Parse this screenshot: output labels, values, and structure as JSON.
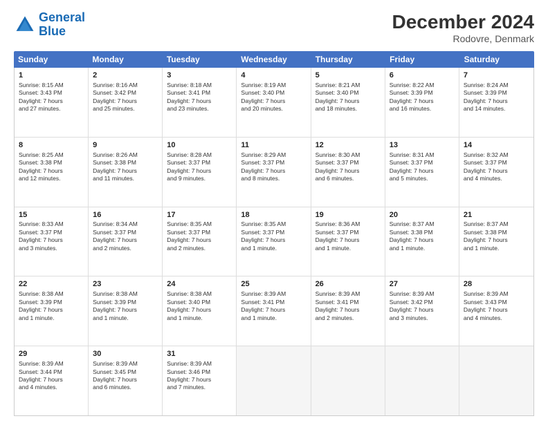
{
  "header": {
    "logo_line1": "General",
    "logo_line2": "Blue",
    "main_title": "December 2024",
    "subtitle": "Rodovre, Denmark"
  },
  "days_of_week": [
    "Sunday",
    "Monday",
    "Tuesday",
    "Wednesday",
    "Thursday",
    "Friday",
    "Saturday"
  ],
  "weeks": [
    [
      {
        "day": "1",
        "lines": [
          "Sunrise: 8:15 AM",
          "Sunset: 3:43 PM",
          "Daylight: 7 hours",
          "and 27 minutes."
        ]
      },
      {
        "day": "2",
        "lines": [
          "Sunrise: 8:16 AM",
          "Sunset: 3:42 PM",
          "Daylight: 7 hours",
          "and 25 minutes."
        ]
      },
      {
        "day": "3",
        "lines": [
          "Sunrise: 8:18 AM",
          "Sunset: 3:41 PM",
          "Daylight: 7 hours",
          "and 23 minutes."
        ]
      },
      {
        "day": "4",
        "lines": [
          "Sunrise: 8:19 AM",
          "Sunset: 3:40 PM",
          "Daylight: 7 hours",
          "and 20 minutes."
        ]
      },
      {
        "day": "5",
        "lines": [
          "Sunrise: 8:21 AM",
          "Sunset: 3:40 PM",
          "Daylight: 7 hours",
          "and 18 minutes."
        ]
      },
      {
        "day": "6",
        "lines": [
          "Sunrise: 8:22 AM",
          "Sunset: 3:39 PM",
          "Daylight: 7 hours",
          "and 16 minutes."
        ]
      },
      {
        "day": "7",
        "lines": [
          "Sunrise: 8:24 AM",
          "Sunset: 3:39 PM",
          "Daylight: 7 hours",
          "and 14 minutes."
        ]
      }
    ],
    [
      {
        "day": "8",
        "lines": [
          "Sunrise: 8:25 AM",
          "Sunset: 3:38 PM",
          "Daylight: 7 hours",
          "and 12 minutes."
        ]
      },
      {
        "day": "9",
        "lines": [
          "Sunrise: 8:26 AM",
          "Sunset: 3:38 PM",
          "Daylight: 7 hours",
          "and 11 minutes."
        ]
      },
      {
        "day": "10",
        "lines": [
          "Sunrise: 8:28 AM",
          "Sunset: 3:37 PM",
          "Daylight: 7 hours",
          "and 9 minutes."
        ]
      },
      {
        "day": "11",
        "lines": [
          "Sunrise: 8:29 AM",
          "Sunset: 3:37 PM",
          "Daylight: 7 hours",
          "and 8 minutes."
        ]
      },
      {
        "day": "12",
        "lines": [
          "Sunrise: 8:30 AM",
          "Sunset: 3:37 PM",
          "Daylight: 7 hours",
          "and 6 minutes."
        ]
      },
      {
        "day": "13",
        "lines": [
          "Sunrise: 8:31 AM",
          "Sunset: 3:37 PM",
          "Daylight: 7 hours",
          "and 5 minutes."
        ]
      },
      {
        "day": "14",
        "lines": [
          "Sunrise: 8:32 AM",
          "Sunset: 3:37 PM",
          "Daylight: 7 hours",
          "and 4 minutes."
        ]
      }
    ],
    [
      {
        "day": "15",
        "lines": [
          "Sunrise: 8:33 AM",
          "Sunset: 3:37 PM",
          "Daylight: 7 hours",
          "and 3 minutes."
        ]
      },
      {
        "day": "16",
        "lines": [
          "Sunrise: 8:34 AM",
          "Sunset: 3:37 PM",
          "Daylight: 7 hours",
          "and 2 minutes."
        ]
      },
      {
        "day": "17",
        "lines": [
          "Sunrise: 8:35 AM",
          "Sunset: 3:37 PM",
          "Daylight: 7 hours",
          "and 2 minutes."
        ]
      },
      {
        "day": "18",
        "lines": [
          "Sunrise: 8:35 AM",
          "Sunset: 3:37 PM",
          "Daylight: 7 hours",
          "and 1 minute."
        ]
      },
      {
        "day": "19",
        "lines": [
          "Sunrise: 8:36 AM",
          "Sunset: 3:37 PM",
          "Daylight: 7 hours",
          "and 1 minute."
        ]
      },
      {
        "day": "20",
        "lines": [
          "Sunrise: 8:37 AM",
          "Sunset: 3:38 PM",
          "Daylight: 7 hours",
          "and 1 minute."
        ]
      },
      {
        "day": "21",
        "lines": [
          "Sunrise: 8:37 AM",
          "Sunset: 3:38 PM",
          "Daylight: 7 hours",
          "and 1 minute."
        ]
      }
    ],
    [
      {
        "day": "22",
        "lines": [
          "Sunrise: 8:38 AM",
          "Sunset: 3:39 PM",
          "Daylight: 7 hours",
          "and 1 minute."
        ]
      },
      {
        "day": "23",
        "lines": [
          "Sunrise: 8:38 AM",
          "Sunset: 3:39 PM",
          "Daylight: 7 hours",
          "and 1 minute."
        ]
      },
      {
        "day": "24",
        "lines": [
          "Sunrise: 8:38 AM",
          "Sunset: 3:40 PM",
          "Daylight: 7 hours",
          "and 1 minute."
        ]
      },
      {
        "day": "25",
        "lines": [
          "Sunrise: 8:39 AM",
          "Sunset: 3:41 PM",
          "Daylight: 7 hours",
          "and 1 minute."
        ]
      },
      {
        "day": "26",
        "lines": [
          "Sunrise: 8:39 AM",
          "Sunset: 3:41 PM",
          "Daylight: 7 hours",
          "and 2 minutes."
        ]
      },
      {
        "day": "27",
        "lines": [
          "Sunrise: 8:39 AM",
          "Sunset: 3:42 PM",
          "Daylight: 7 hours",
          "and 3 minutes."
        ]
      },
      {
        "day": "28",
        "lines": [
          "Sunrise: 8:39 AM",
          "Sunset: 3:43 PM",
          "Daylight: 7 hours",
          "and 4 minutes."
        ]
      }
    ],
    [
      {
        "day": "29",
        "lines": [
          "Sunrise: 8:39 AM",
          "Sunset: 3:44 PM",
          "Daylight: 7 hours",
          "and 4 minutes."
        ]
      },
      {
        "day": "30",
        "lines": [
          "Sunrise: 8:39 AM",
          "Sunset: 3:45 PM",
          "Daylight: 7 hours",
          "and 6 minutes."
        ]
      },
      {
        "day": "31",
        "lines": [
          "Sunrise: 8:39 AM",
          "Sunset: 3:46 PM",
          "Daylight: 7 hours",
          "and 7 minutes."
        ]
      },
      {
        "day": "",
        "lines": []
      },
      {
        "day": "",
        "lines": []
      },
      {
        "day": "",
        "lines": []
      },
      {
        "day": "",
        "lines": []
      }
    ]
  ]
}
